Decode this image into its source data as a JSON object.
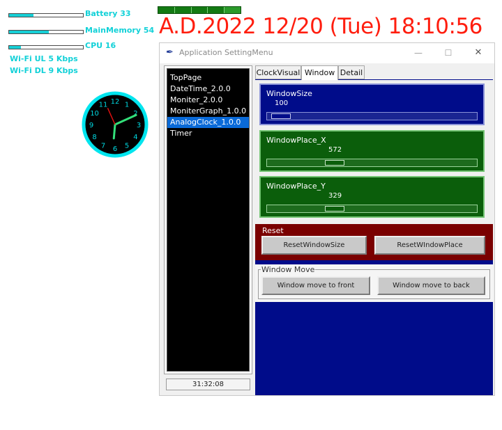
{
  "meters": [
    {
      "label": "Battery 33",
      "fill": 0.33
    },
    {
      "label": "MainMemory 54",
      "fill": 0.54
    },
    {
      "label": "CPU 16",
      "fill": 0.16
    }
  ],
  "network": {
    "wifi_ul": "Wi-Fi UL 5 Kbps",
    "wifi_dl": "Wi-Fi DL 9 Kbps"
  },
  "datetime": "A.D.2022  12/20 (Tue) 18:10:56",
  "analog_clock": {
    "numbers": [
      "12",
      "1",
      "2",
      "3",
      "4",
      "5",
      "6",
      "7",
      "8",
      "9",
      "10",
      "11"
    ],
    "hour": 18,
    "minute": 10,
    "second": 56,
    "colors": {
      "ring": "#00e5ee",
      "face": "#000000",
      "hour_hand": "#33e07a",
      "minute_hand": "#33e07a",
      "second_hand": "#e01010",
      "numbers": "#00d8e0"
    }
  },
  "window": {
    "title": "Application SettingMenu",
    "controls": {
      "minimize": "—",
      "maximize": "☐",
      "close": "✕"
    }
  },
  "app_list": {
    "items": [
      "TopPage",
      "DateTime_2.0.0",
      "Moniter_2.0.0",
      "MoniterGraph_1.0.0",
      "AnalogClock_1.0.0",
      "Timer"
    ],
    "selected_index": 4
  },
  "timer_value": "31:32:08",
  "tabs": [
    "ClockVisual",
    "Window",
    "Detail"
  ],
  "active_tab": "Window",
  "scales": {
    "window_size": {
      "label": "WindowSize",
      "value": "100",
      "fraction": 0.02
    },
    "window_place_x": {
      "label": "WindowPlace_X",
      "value": "572",
      "fraction": 0.3
    },
    "window_place_y": {
      "label": "WindowPlace_Y",
      "value": "329",
      "fraction": 0.3
    }
  },
  "reset": {
    "label": "Reset",
    "reset_size": "ResetWindowSize",
    "reset_place": "ResetWIndowPlace"
  },
  "window_move": {
    "label": "Window Move",
    "to_front": "Window move to front",
    "to_back": "Window move to back"
  },
  "colors": {
    "meter_accent": "#17d0d6",
    "datetime": "#ff1d0e",
    "scale_blue": "#000c8a",
    "scale_green": "#0b5e0b",
    "reset_red": "#7a0000"
  }
}
